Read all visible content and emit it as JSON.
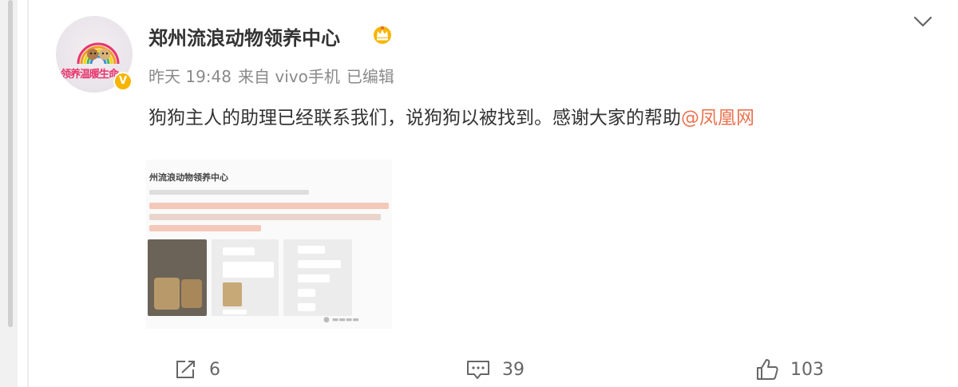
{
  "post": {
    "author": "郑州流浪动物领养中心",
    "avatar_text": "领养温暖生命",
    "verified_mark": "V",
    "time": "昨天 19:48",
    "source": "来自 vivo手机",
    "edited": "已编辑",
    "text": "狗狗主人的助理已经联系我们，说狗狗以被找到。感谢大家的帮助",
    "mention": "@凤凰网",
    "mention_color": "#eb7350",
    "icons": {
      "vip": "crown-badge-icon",
      "menu": "chevron-down-icon"
    }
  },
  "image": {
    "title": "州流浪动物领养中心"
  },
  "actions": {
    "repost": {
      "icon": "repost-icon",
      "count": "6"
    },
    "comment": {
      "icon": "comment-icon",
      "count": "39"
    },
    "like": {
      "icon": "thumbs-up-icon",
      "count": "103"
    }
  }
}
